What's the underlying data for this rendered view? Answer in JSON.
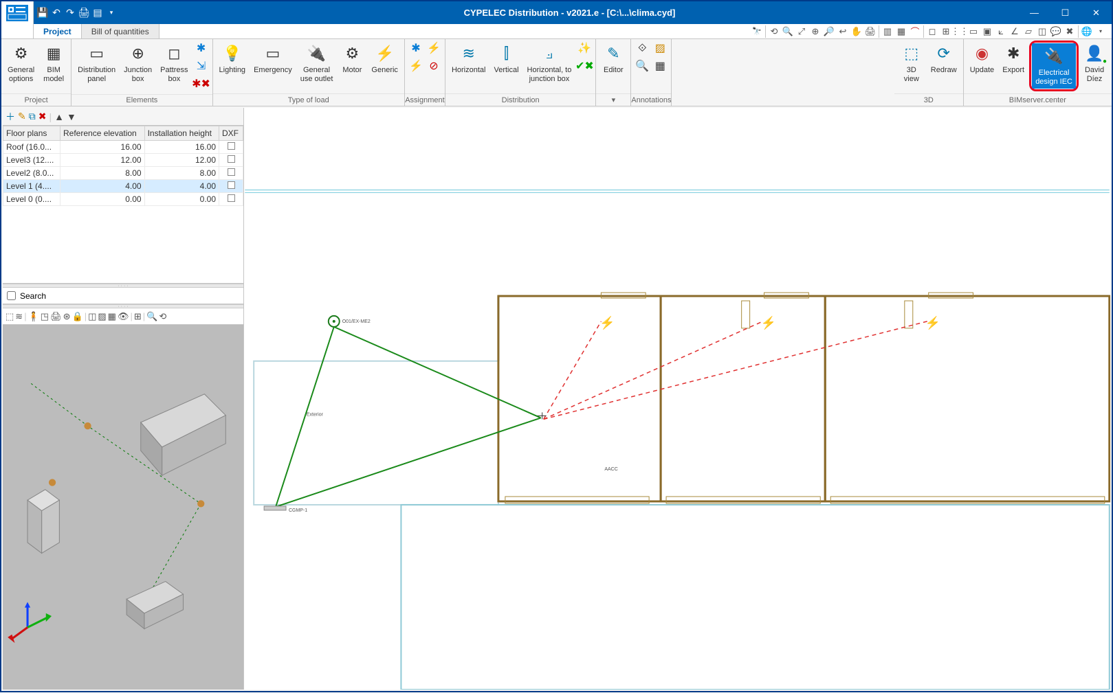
{
  "title": "CYPELEC Distribution - v2021.e - [C:\\...\\clima.cyd]",
  "tabs": {
    "project": "Project",
    "boq": "Bill of quantities"
  },
  "ribbon": {
    "project": {
      "label": "Project",
      "general_options": "General\noptions",
      "bim_model": "BIM\nmodel"
    },
    "elements": {
      "label": "Elements",
      "distribution_panel": "Distribution\npanel",
      "junction_box": "Junction\nbox",
      "pattress_box": "Pattress\nbox"
    },
    "load": {
      "label": "Type of load",
      "lighting": "Lighting",
      "emergency": "Emergency",
      "general_use": "General\nuse outlet",
      "motor": "Motor",
      "generic": "Generic"
    },
    "assignment": {
      "label": "Assignment"
    },
    "distribution": {
      "label": "Distribution",
      "horizontal": "Horizontal",
      "vertical": "Vertical",
      "horiz_junction": "Horizontal, to\njunction box"
    },
    "editor": {
      "label": "",
      "editor": "Editor"
    },
    "annotations": {
      "label": "Annotations"
    },
    "threeD": {
      "label": "3D",
      "view": "3D\nview",
      "redraw": "Redraw"
    },
    "bimserver": {
      "label": "BIMserver.center",
      "update": "Update",
      "export": "Export",
      "electrical": "Electrical\ndesign IEC",
      "user": "David\nDíez"
    }
  },
  "floor_table": {
    "headers": {
      "name": "Floor plans",
      "ref": "Reference elevation",
      "inst": "Installation height",
      "dxf": "DXF"
    },
    "rows": [
      {
        "name": "Roof (16.0...",
        "ref": "16.00",
        "inst": "16.00"
      },
      {
        "name": "Level3 (12....",
        "ref": "12.00",
        "inst": "12.00"
      },
      {
        "name": "Level2 (8.0...",
        "ref": "8.00",
        "inst": "8.00"
      },
      {
        "name": "Level 1 (4....",
        "ref": "4.00",
        "inst": "4.00",
        "selected": true
      },
      {
        "name": "Level 0 (0....",
        "ref": "0.00",
        "inst": "0.00"
      }
    ]
  },
  "search_label": "Search",
  "canvas_labels": {
    "node1": "O01/EX-ME2",
    "exterior": "Exterior",
    "aacc": "AACC",
    "cgmp": "CGMP-1"
  }
}
